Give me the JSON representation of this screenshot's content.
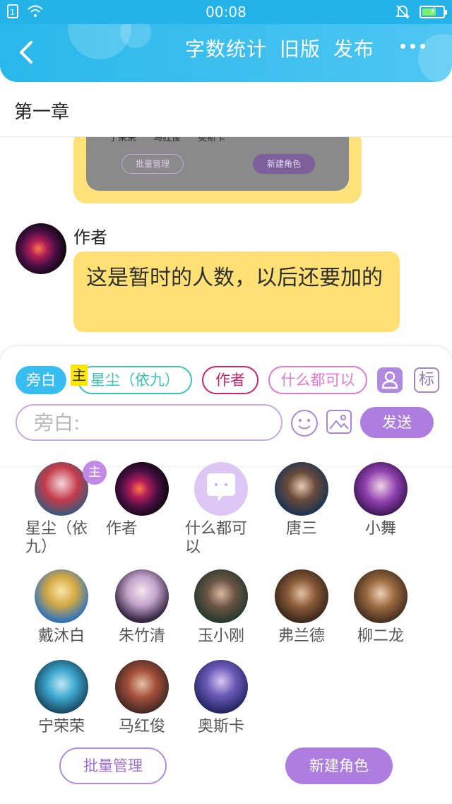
{
  "status_bar": {
    "time": "00:08"
  },
  "header": {
    "actions": [
      "字数统计",
      "旧版",
      "发布"
    ]
  },
  "chapter": {
    "title": "第一章"
  },
  "chat": {
    "preview_names": [
      "宁荣荣",
      "马红俊",
      "奥斯卡"
    ],
    "preview_batch_label": "批量管理",
    "preview_new_label": "新建角色",
    "message": {
      "sender": "作者",
      "text": "这是暂时的人数，以后还要加的"
    }
  },
  "composer": {
    "chips": {
      "narrator": "旁白",
      "xingchen": "星尘（依九）",
      "author": "作者",
      "anything": "什么都可以"
    },
    "main_tag": "主",
    "mark_label": "标",
    "input_placeholder": "旁白:",
    "send_label": "发送"
  },
  "characters": {
    "main_badge": "主",
    "items": [
      {
        "name": "星尘（依九）"
      },
      {
        "name": "作者"
      },
      {
        "name": "什么都可以"
      },
      {
        "name": "唐三"
      },
      {
        "name": "小舞"
      },
      {
        "name": "戴沐白"
      },
      {
        "name": "朱竹清"
      },
      {
        "name": "玉小刚"
      },
      {
        "name": "弗兰德"
      },
      {
        "name": "柳二龙"
      },
      {
        "name": "宁荣荣"
      },
      {
        "name": "马红俊"
      },
      {
        "name": "奥斯卡"
      }
    ],
    "batch_label": "批量管理",
    "new_label": "新建角色"
  },
  "colors": {
    "header": "#29b8ea",
    "accent_purple": "#ad7ee0",
    "bubble_yellow": "#ffe074"
  }
}
